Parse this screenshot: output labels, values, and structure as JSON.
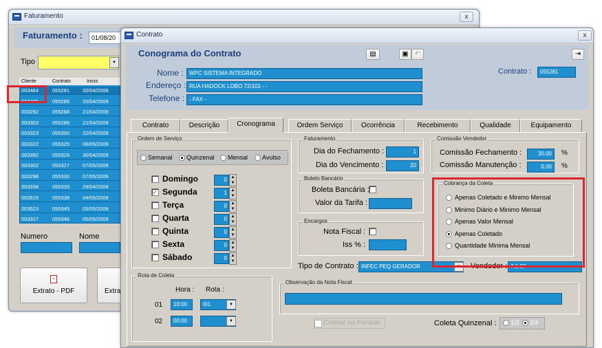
{
  "back_window": {
    "title": "Faturamento",
    "close_label": "x",
    "faturamento_label": "Faturamento :",
    "faturamento_value": "01/08/20",
    "tipo_label": "Tipo",
    "grid_headers": [
      "Cliente",
      "Contrato",
      "Inicio"
    ],
    "grid_rows": [
      [
        "003464",
        "055281",
        "20/04/2009"
      ],
      [
        "003465",
        "055285",
        "20/04/2009"
      ],
      [
        "003292",
        "055288",
        "21/04/2009"
      ],
      [
        "003303",
        "055289",
        "21/04/2009"
      ],
      [
        "003323",
        "055300",
        "22/04/2009"
      ],
      [
        "003322",
        "055325",
        "06/05/2009"
      ],
      [
        "003392",
        "055326",
        "30/04/2009"
      ],
      [
        "003302",
        "055327",
        "07/05/2009"
      ],
      [
        "003298",
        "055330",
        "07/05/2009"
      ],
      [
        "003338",
        "055333",
        "29/04/2009"
      ],
      [
        "003515",
        "055338",
        "04/05/2009"
      ],
      [
        "003523",
        "055345",
        "05/05/2009"
      ],
      [
        "003327",
        "055346",
        "05/05/2009"
      ]
    ],
    "numero_label": "Numero",
    "nome_label": "Nome",
    "extrato_pdf_label": "Extrato - PDF",
    "extra_label": "Extra"
  },
  "contract_window": {
    "title": "Contrato",
    "close_label": "x",
    "header": "Conograma do Contrato",
    "nome_label": "Nome :",
    "nome_value": "WPC SISTEMA INTEGRADO",
    "endereco_label": "Endereço :",
    "endereco_value": "RUA HADOCK LOBO 72/101 - -",
    "telefone_label": "Telefone :",
    "telefone_value": "- FAX -",
    "contrato_label": "Contrato :",
    "contrato_value": "055281",
    "tabs": [
      "Contrato",
      "Descrição",
      "Cronograma",
      "Ordem Serviço",
      "Ocorrência",
      "Recebimento",
      "Qualidade",
      "Equipamento"
    ],
    "active_tab": "Cronograma",
    "ordem_servico": {
      "title": "Ordem de Serviço",
      "options": [
        "Semanal",
        "Quinzenal",
        "Mensal",
        "Avulso"
      ],
      "selected": "Quinzenal",
      "days": [
        {
          "label": "Domingo",
          "checked": false,
          "value": "0"
        },
        {
          "label": "Segunda",
          "checked": true,
          "value": "1"
        },
        {
          "label": "Terça",
          "checked": false,
          "value": "0"
        },
        {
          "label": "Quarta",
          "checked": false,
          "value": "0"
        },
        {
          "label": "Quinta",
          "checked": false,
          "value": "0"
        },
        {
          "label": "Sexta",
          "checked": false,
          "value": "0"
        },
        {
          "label": "Sábado",
          "checked": false,
          "value": "0"
        }
      ]
    },
    "faturamento": {
      "title": "Faturamento",
      "fechamento_label": "Dia do Fechamento :",
      "fechamento_value": "1",
      "vencimento_label": "Dia do Vencimento :",
      "vencimento_value": "20"
    },
    "boleto": {
      "title": "Boleto Bancário",
      "bancaria_label": "Boleta Bancária :",
      "tarifa_label": "Valor da Tarifa :"
    },
    "encargos": {
      "title": "Encargos",
      "nota_label": "Nota Fiscal :",
      "iss_label": "Iss % :"
    },
    "tipo_contrato_label": "Tipo de Contrato :",
    "tipo_contrato_value": "INFEC PEQ GERADOR",
    "vendedor_label": "Vendedor :",
    "vendedor_value": "7.1.07",
    "comissao": {
      "title": "Comissão Vendedor",
      "fechamento_label": "Comissão Fechamento :",
      "fechamento_value": "30.00",
      "manutencao_label": "Comissão Manutenção :",
      "manutencao_value": "0.00",
      "unit": "%"
    },
    "cobranca": {
      "title": "Cobrança da Coleta",
      "options": [
        "Apenas Coletado e Minimo Mensal",
        "Minimo Diário e Minimo Mensal",
        "Apenas Valor Mensal",
        "Apenas Coletado",
        "Quantidade Minima Mensal"
      ],
      "selected": "Apenas Coletado"
    },
    "rota": {
      "title": "Rota de Coleta",
      "hora_label": "Hora :",
      "rota_label": "Rota :",
      "rows": [
        {
          "num": "01",
          "hora": "10:00",
          "rota": "I01"
        },
        {
          "num": "02",
          "hora": "00:00",
          "rota": ""
        }
      ]
    },
    "observacao_title": "Observação da Nota Fiscal",
    "coletar_label": "Coletar no Feriado",
    "coleta_quinzenal_label": "Coleta Quinzenal :",
    "coleta_quinzenal_options": [
      "1/3",
      "2/4"
    ]
  },
  "colors": {
    "field_blue": "#1f8fcf",
    "highlight_red": "#e0242c",
    "header_blue": "#1c3f7c"
  }
}
